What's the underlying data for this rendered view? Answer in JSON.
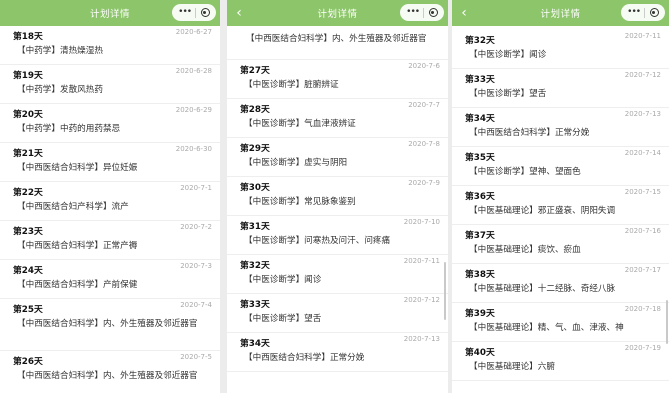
{
  "nav": {
    "title": "计划详情",
    "back_glyph": "‹",
    "more_glyph": "•••"
  },
  "panels": [
    {
      "items": [
        {
          "day": "第18天",
          "date": "2020-6-27",
          "subject": "【中药学】清热燥湿热"
        },
        {
          "day": "第19天",
          "date": "2020-6-28",
          "subject": "【中药学】发散风热药"
        },
        {
          "day": "第20天",
          "date": "2020-6-29",
          "subject": "【中药学】中药的用药禁忌"
        },
        {
          "day": "第21天",
          "date": "2020-6-30",
          "subject": "【中西医结合妇科学】异位妊娠"
        },
        {
          "day": "第22天",
          "date": "2020-7-1",
          "subject": "【中西医结合妇产科学】流产"
        },
        {
          "day": "第23天",
          "date": "2020-7-2",
          "subject": "【中西医结合妇科学】正常产褥"
        },
        {
          "day": "第24天",
          "date": "2020-7-3",
          "subject": "【中西医结合妇科学】产前保健"
        },
        {
          "day": "第25天",
          "date": "2020-7-4",
          "subject": "【中西医结合妇科学】内、外生殖器及邻近器官"
        },
        {
          "day": "第26天",
          "date": "2020-7-5",
          "subject": "【中西医结合妇科学】内、外生殖器及邻近器官"
        }
      ]
    },
    {
      "partial": {
        "subject": "【中西医结合妇科学】内、外生殖器及邻近器官"
      },
      "items": [
        {
          "day": "第27天",
          "date": "2020-7-6",
          "subject": "【中医诊断学】脏腑辨证"
        },
        {
          "day": "第28天",
          "date": "2020-7-7",
          "subject": "【中医诊断学】气血津液辨证"
        },
        {
          "day": "第29天",
          "date": "2020-7-8",
          "subject": "【中医诊断学】虚实与阴阳"
        },
        {
          "day": "第30天",
          "date": "2020-7-9",
          "subject": "【中医诊断学】常见脉象鉴别"
        },
        {
          "day": "第31天",
          "date": "2020-7-10",
          "subject": "【中医诊断学】问寒热及问汗、问疼痛"
        },
        {
          "day": "第32天",
          "date": "2020-7-11",
          "subject": "【中医诊断学】闻诊"
        },
        {
          "day": "第33天",
          "date": "2020-7-12",
          "subject": "【中医诊断学】望舌"
        },
        {
          "day": "第34天",
          "date": "2020-7-13",
          "subject": "【中西医结合妇科学】正常分娩"
        }
      ]
    },
    {
      "items": [
        {
          "day": "第32天",
          "date": "2020-7-11",
          "subject": "【中医诊断学】闻诊"
        },
        {
          "day": "第33天",
          "date": "2020-7-12",
          "subject": "【中医诊断学】望舌"
        },
        {
          "day": "第34天",
          "date": "2020-7-13",
          "subject": "【中西医结合妇科学】正常分娩"
        },
        {
          "day": "第35天",
          "date": "2020-7-14",
          "subject": "【中医诊断学】望神、望面色"
        },
        {
          "day": "第36天",
          "date": "2020-7-15",
          "subject": "【中医基础理论】邪正盛衰、阴阳失调"
        },
        {
          "day": "第37天",
          "date": "2020-7-16",
          "subject": "【中医基础理论】痰饮、瘀血"
        },
        {
          "day": "第38天",
          "date": "2020-7-17",
          "subject": "【中医基础理论】十二经脉、奇经八脉"
        },
        {
          "day": "第39天",
          "date": "2020-7-18",
          "subject": "【中医基础理论】精、气、血、津液、神"
        },
        {
          "day": "第40天",
          "date": "2020-7-19",
          "subject": "【中医基础理论】六腑"
        }
      ]
    }
  ],
  "colors": {
    "navbar": "#8cc56a",
    "date": "#aaaaaa",
    "divider": "#eeeeee"
  }
}
